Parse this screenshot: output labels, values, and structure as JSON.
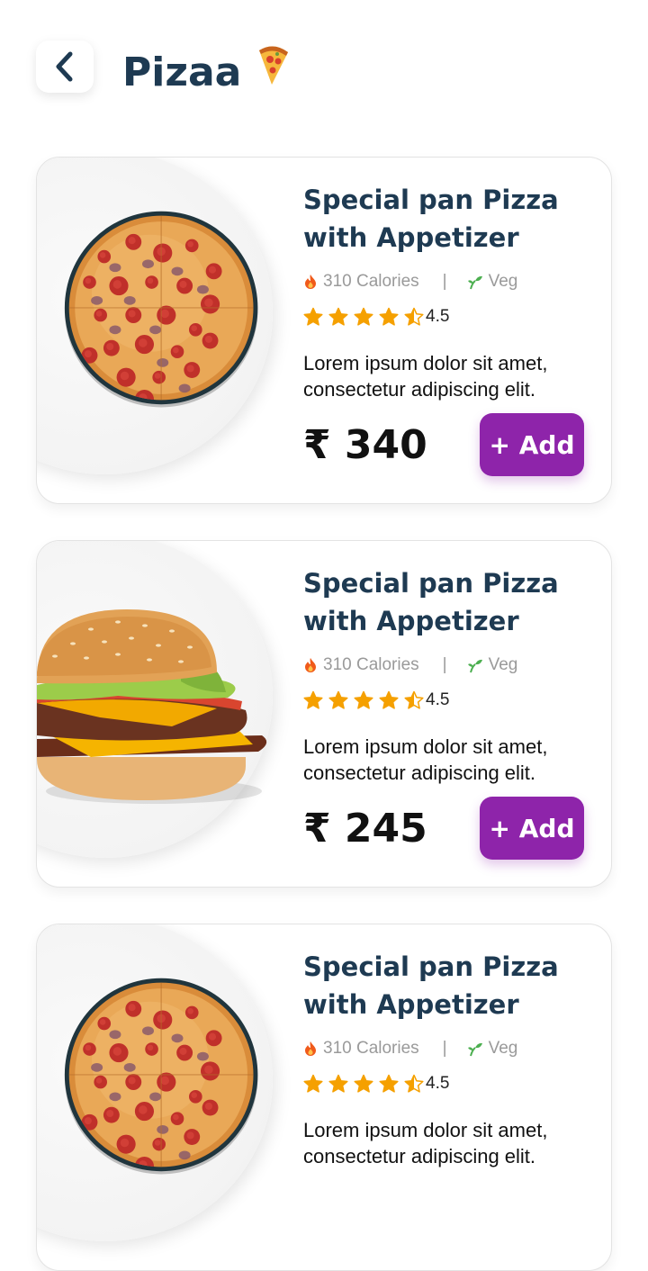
{
  "header": {
    "title": "Pizaa",
    "title_emoji": "🍕",
    "back_icon": "chevron-left-icon"
  },
  "products": [
    {
      "food_icon": "pizza-image",
      "name": "Special pan Pizza with Appetizer",
      "calories": "310 Calories",
      "separator": "|",
      "diet": "Veg",
      "rating_stars": 4.5,
      "rating": "4.5",
      "description": "Lorem ipsum dolor sit amet, consectetur adipiscing elit.",
      "price": "₹ 340",
      "add_label": "+ Add"
    },
    {
      "food_icon": "burger-image",
      "name": "Special pan Pizza with Appetizer",
      "calories": "310 Calories",
      "separator": "|",
      "diet": "Veg",
      "rating_stars": 4.5,
      "rating": "4.5",
      "description": "Lorem ipsum dolor sit amet, consectetur adipiscing elit.",
      "price": "₹ 245",
      "add_label": "+ Add"
    },
    {
      "food_icon": "pizza-image",
      "name": "Special pan Pizza with Appetizer",
      "calories": "310 Calories",
      "separator": "|",
      "diet": "Veg",
      "rating_stars": 4.5,
      "rating": "4.5",
      "description": "Lorem ipsum dolor sit amet, consectetur adipiscing elit.",
      "price": "",
      "add_label": ""
    }
  ],
  "colors": {
    "title": "#1e3a52",
    "accent": "#8e24aa",
    "star": "#f5a000",
    "leaf": "#4caf50",
    "flame": "#f05a1a"
  }
}
